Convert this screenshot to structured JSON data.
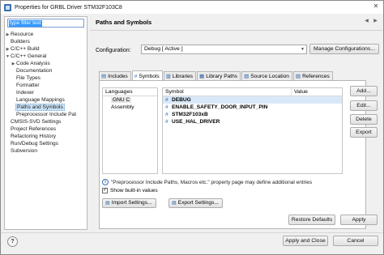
{
  "window": {
    "title": "Properties for GRBL Driver STM32F103C8",
    "close": "✕"
  },
  "filter": {
    "value": "type filter text"
  },
  "tree": {
    "items": [
      {
        "label": "Resource",
        "arrow": "▶"
      },
      {
        "label": "Builders",
        "arrow": ""
      },
      {
        "label": "C/C++ Build",
        "arrow": "▶"
      },
      {
        "label": "C/C++ General",
        "arrow": "▼"
      },
      {
        "label": "Code Analysis",
        "arrow": "▶"
      },
      {
        "label": "Documentation",
        "arrow": ""
      },
      {
        "label": "File Types",
        "arrow": ""
      },
      {
        "label": "Formatter",
        "arrow": ""
      },
      {
        "label": "Indexer",
        "arrow": ""
      },
      {
        "label": "Language Mappings",
        "arrow": ""
      },
      {
        "label": "Paths and Symbols",
        "arrow": ""
      },
      {
        "label": "Preprocessor Include Pat",
        "arrow": ""
      },
      {
        "label": "CMSIS-SVD Settings",
        "arrow": ""
      },
      {
        "label": "Project References",
        "arrow": ""
      },
      {
        "label": "Refactoring History",
        "arrow": ""
      },
      {
        "label": "Run/Debug Settings",
        "arrow": ""
      },
      {
        "label": "Subversion",
        "arrow": ""
      }
    ]
  },
  "pane": {
    "title": "Paths and Symbols",
    "configuration_label": "Configuration:",
    "configuration_value": "Debug  [ Active ]",
    "manage_button": "Manage Configurations...",
    "tabs": [
      {
        "label": "Includes",
        "icon": "▤"
      },
      {
        "label": "Symbols",
        "icon": "#"
      },
      {
        "label": "Libraries",
        "icon": "▥"
      },
      {
        "label": "Library Paths",
        "icon": "▦"
      },
      {
        "label": "Source Location",
        "icon": "▧"
      },
      {
        "label": "References",
        "icon": "▨"
      }
    ],
    "languages_header": "Languages",
    "languages": [
      "GNU C",
      "Assembly"
    ],
    "symbol_header": "Symbol",
    "value_header": "Value",
    "symbols": [
      "DEBUG",
      "ENABLE_SAFETY_DOOR_INPUT_PIN",
      "STM32F103xB",
      "USE_HAL_DRIVER"
    ],
    "side_buttons": {
      "add": "Add...",
      "edit": "Edit...",
      "delete": "Delete",
      "export": "Export"
    },
    "info_text": "\"Preprocessor Include Paths, Macros etc.\" property page may define additional entries",
    "show_builtin": "Show built-in values",
    "import_button": "Import Settings...",
    "export_button": "Export Settings...",
    "restore_button": "Restore Defaults",
    "apply_button": "Apply"
  },
  "footer": {
    "help": "?",
    "apply_close": "Apply and Close",
    "cancel": "Cancel"
  },
  "colors": {
    "accent": "#3399ff",
    "selection": "#cce4f7",
    "icon_blue": "#2b5ea3"
  }
}
